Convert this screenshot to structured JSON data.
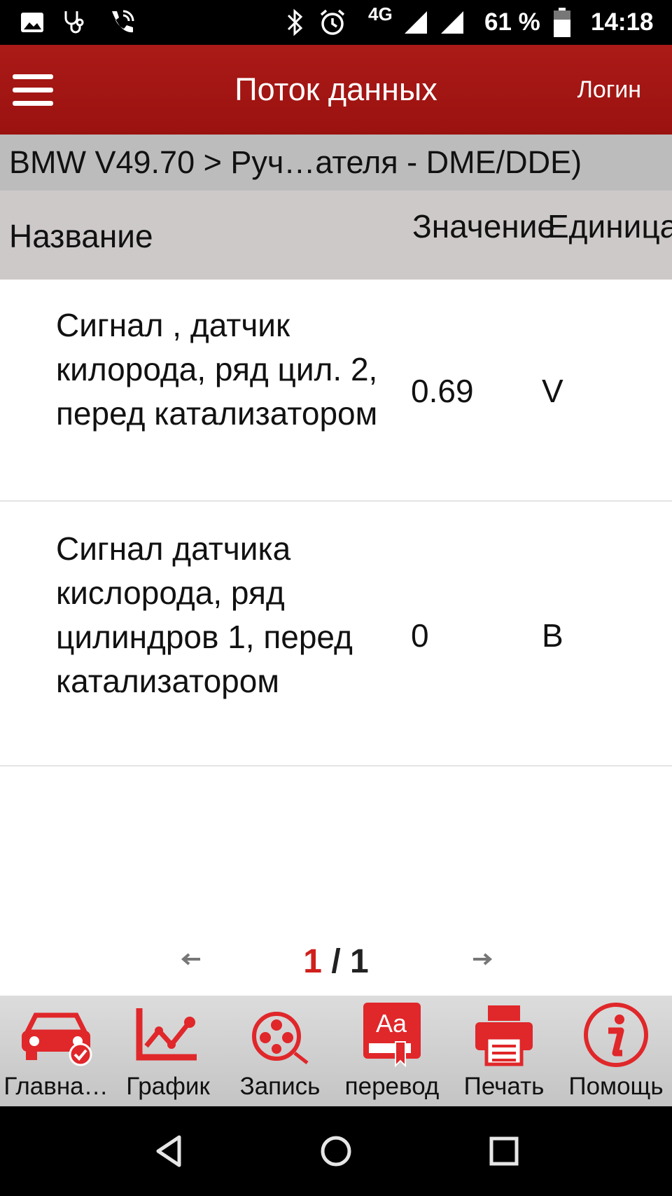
{
  "status_bar": {
    "network": "4G",
    "battery": "61 %",
    "time": "14:18"
  },
  "app_bar": {
    "title": "Поток данных",
    "login_label": "Логин"
  },
  "breadcrumb": "BMW V49.70 > Руч…ателя - DME/DDE)",
  "table": {
    "columns": [
      "Название",
      "Значение",
      "Единица"
    ],
    "rows": [
      {
        "name": "Сигнал , датчик килорода, ряд цил. 2, перед катализатором",
        "value": "0.69",
        "unit": "V"
      },
      {
        "name": "Сигнал датчика кислорода, ряд цилиндров 1, перед катализатором",
        "value": "0",
        "unit": "В"
      }
    ]
  },
  "pagination": {
    "current": "1",
    "separator": "/",
    "total": "1"
  },
  "toolbar": {
    "items": [
      {
        "label": "Главна…",
        "icon": "car-check-icon"
      },
      {
        "label": "График",
        "icon": "graph-icon"
      },
      {
        "label": "Запись",
        "icon": "film-reel-icon"
      },
      {
        "label": "перевод",
        "icon": "translate-icon"
      },
      {
        "label": "Печать",
        "icon": "printer-icon"
      },
      {
        "label": "Помощь",
        "icon": "info-icon"
      }
    ]
  },
  "colors": {
    "accent": "#a5161a",
    "icon_red": "#e0272a",
    "page_current": "#d0201c"
  }
}
